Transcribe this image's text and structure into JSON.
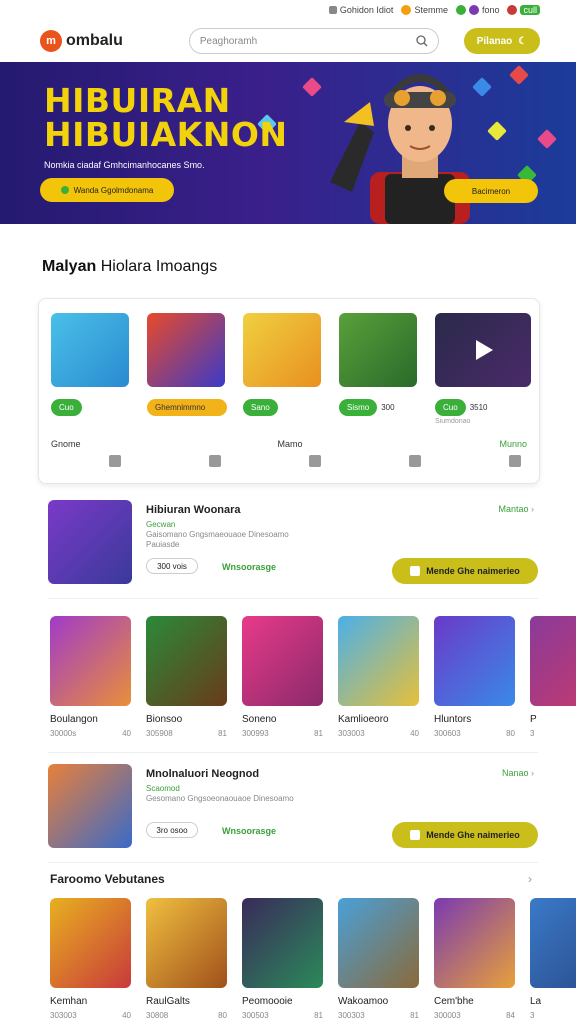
{
  "util_bar": {
    "items": [
      "Gohidon Idiot",
      "Stemme",
      "fono",
      "cull"
    ]
  },
  "header": {
    "logo_text": "ombalu",
    "logo_mark": "m",
    "search_placeholder": "Peaghoramh",
    "cta_label": "Pilanao"
  },
  "hero": {
    "title_line1": "HIBUIRAN",
    "title_line2": "HIBUIAKNON",
    "subtitle": "Nomkia ciadaf Gmhcimanhocanes Smo.",
    "btn_primary": "Wanda Ggolmdonama",
    "btn_secondary": "Bacimeron"
  },
  "section": {
    "title_bold": "Malyan",
    "title_rest": "Hiolara Imoangs"
  },
  "panel": {
    "items": [
      {
        "badge": "Cuo",
        "side": "",
        "color": "#3ab0e0"
      },
      {
        "badge": "Ghemnimmno",
        "side": "",
        "color": "#d84a2a",
        "orange": true
      },
      {
        "badge": "Sano",
        "side": "",
        "color": "#e8a020"
      },
      {
        "badge": "Sismo",
        "side": "300",
        "color": "#4a8a2a"
      },
      {
        "badge": "Cuo",
        "side": "3510",
        "color": "#2a2a4a",
        "note": "Siumdonao"
      }
    ],
    "row_labels": [
      "Gnome",
      "Mamo",
      "Munno"
    ]
  },
  "featured": [
    {
      "title": "Hibiuran Woonara",
      "line1": "Gecwan",
      "line2": "Gaisomano Gngsmaeouaoe Dinesoamo",
      "line3": "Pauiasde",
      "pill": "300 vois",
      "green": "Wnsoorasge",
      "more": "Mantao",
      "cta": "Mende Ghe naimerieo"
    },
    {
      "title": "Mnolnaluori Neognod",
      "line1": "Scaomod",
      "line2": "Gesomano Gngsoeonaouaoe Dinesoamo",
      "line3": "",
      "pill": "3ro osoo",
      "green": "Wnsoorasge",
      "more": "Nanao",
      "cta": "Mende Ghe naimerieo"
    }
  ],
  "grid1": [
    {
      "name": "Boulangon",
      "meta": "30000s",
      "tag": "40",
      "color": "#7a3ab0"
    },
    {
      "name": "Bionsoo",
      "meta": "305908",
      "tag": "81",
      "color": "#2a8a3a"
    },
    {
      "name": "Soneno",
      "meta": "300993",
      "tag": "81",
      "color": "#c83a6a"
    },
    {
      "name": "Kamlioeoro",
      "meta": "303003",
      "tag": "40",
      "color": "#3a8ac8"
    },
    {
      "name": "Hluntors",
      "meta": "300603",
      "tag": "80",
      "color": "#6a3ac8"
    },
    {
      "name": "P",
      "meta": "3",
      "tag": "",
      "color": "#8a3a9a"
    }
  ],
  "grid2_heading": "Faroomo Vebutanes",
  "grid2": [
    {
      "name": "Kemhan",
      "meta": "303003",
      "tag": "40",
      "color": "#e8b020"
    },
    {
      "name": "RaulGalts",
      "meta": "30808",
      "tag": "80",
      "color": "#d09a20"
    },
    {
      "name": "Peomoooie",
      "meta": "300503",
      "tag": "81",
      "color": "#3a2a5a"
    },
    {
      "name": "Wakoamoo",
      "meta": "300303",
      "tag": "81",
      "color": "#4aa0d8"
    },
    {
      "name": "Cem'bhe",
      "meta": "300003",
      "tag": "84",
      "color": "#7a3ab0"
    },
    {
      "name": "La",
      "meta": "3",
      "tag": "",
      "color": "#3a7ac8"
    }
  ]
}
